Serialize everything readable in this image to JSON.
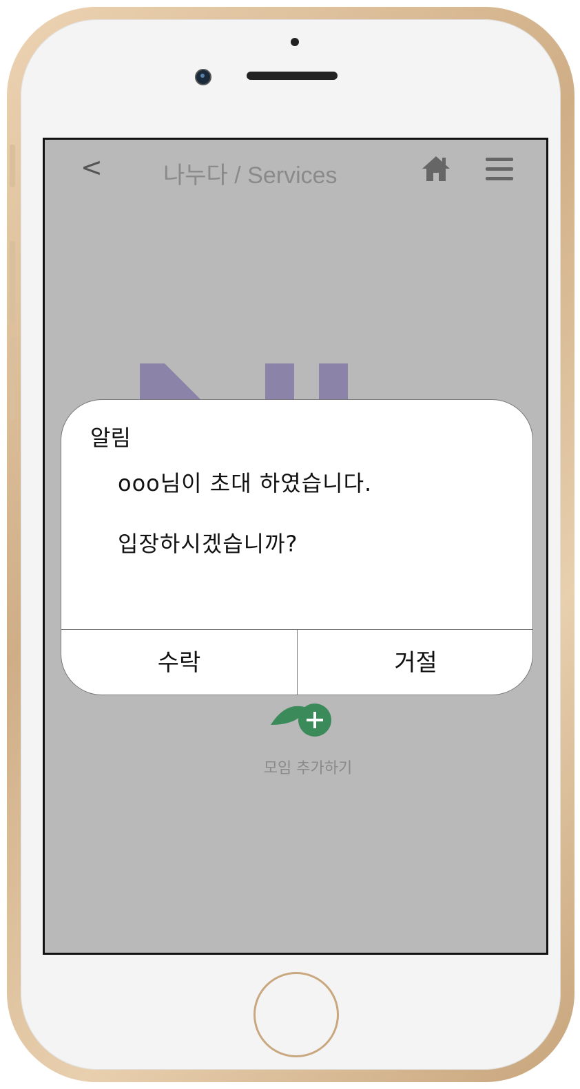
{
  "header": {
    "back_label": "<",
    "title": "나누다 / Services",
    "home_icon": "home-icon",
    "menu_icon": "hamburger-menu-icon"
  },
  "background": {
    "logo_text": "NU",
    "logo_color": "#8c84a8",
    "add_group_label": "모임 추가하기",
    "add_icon": "person-add-icon",
    "add_icon_color": "#3a8a5a"
  },
  "dialog": {
    "title": "알림",
    "message_line1": "ooo님이 초대 하였습니다.",
    "message_line2": "입장하시겠습니까?",
    "accept_label": "수락",
    "reject_label": "거절"
  },
  "colors": {
    "overlay": "#b9b9b9",
    "dialog_bg": "#ffffff",
    "frame_gold": "#cfae86"
  }
}
